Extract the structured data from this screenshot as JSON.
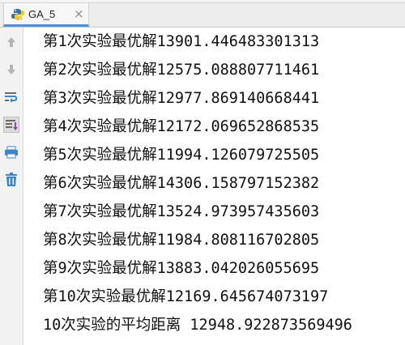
{
  "tab": {
    "title": "GA_5",
    "close": "×"
  },
  "toolbar": {
    "items": [
      {
        "icon": "arrow-up-icon"
      },
      {
        "icon": "arrow-down-icon"
      },
      {
        "icon": "soft-wrap-icon"
      },
      {
        "icon": "scroll-to-end-icon"
      },
      {
        "icon": "print-icon"
      },
      {
        "icon": "trash-icon"
      }
    ]
  },
  "console": {
    "lines": [
      "第1次实验最优解13901.446483301313",
      "第2次实验最优解12575.088807711461",
      "第3次实验最优解12977.869140668441",
      "第4次实验最优解12172.069652868535",
      "第5次实验最优解11994.126079725505",
      "第6次实验最优解14306.158797152382",
      "第7次实验最优解13524.973957435603",
      "第8次实验最优解11984.808116702805",
      "第9次实验最优解13883.042026055695",
      "第10次实验最优解12169.645674073197",
      "10次实验的平均距离 12948.922873569496"
    ]
  },
  "colors": {
    "accent": "#4d8fe0",
    "text": "#111111"
  }
}
